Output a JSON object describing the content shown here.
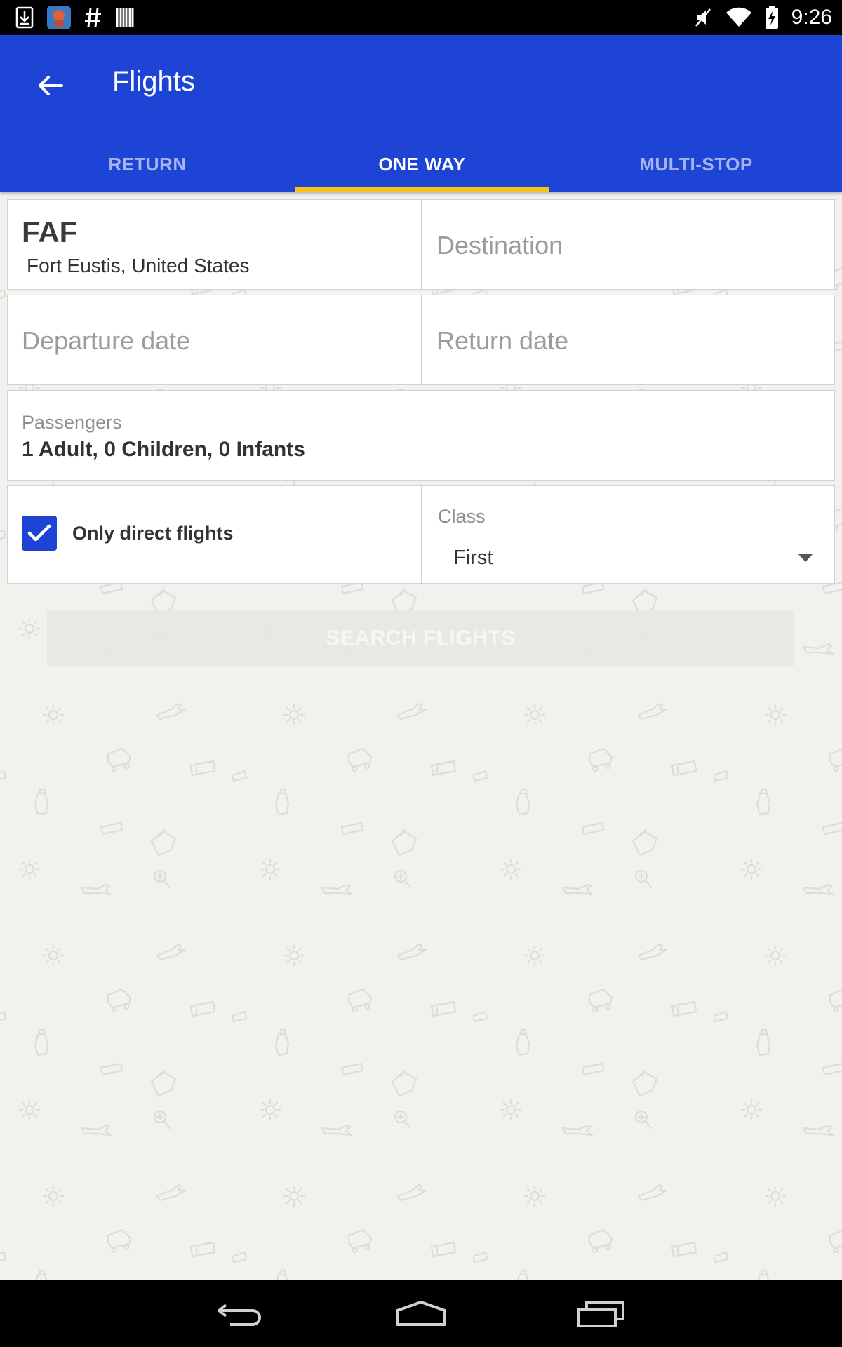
{
  "status_bar": {
    "time": "9:26",
    "left_icons": [
      "download-icon",
      "app-notification-icon",
      "hashtag-icon",
      "barcode-icon"
    ],
    "right_icons": [
      "mute-icon",
      "wifi-icon",
      "battery-charging-icon"
    ]
  },
  "app_bar": {
    "title": "Flights",
    "back_icon": "arrow-back-icon",
    "background": "#1e44d6"
  },
  "tabs": [
    {
      "label": "RETURN",
      "selected": false
    },
    {
      "label": "ONE WAY",
      "selected": true
    },
    {
      "label": "MULTI-STOP",
      "selected": false
    }
  ],
  "indicator_color": "#f5c315",
  "form": {
    "origin": {
      "code": "FAF",
      "city": "Fort Eustis, United States"
    },
    "destination": {
      "placeholder": "Destination"
    },
    "departure_date": {
      "placeholder": "Departure date"
    },
    "return_date": {
      "placeholder": "Return date"
    },
    "passengers": {
      "label": "Passengers",
      "value": "1 Adult, 0 Children, 0 Infants"
    },
    "direct_flights": {
      "label": "Only direct flights",
      "checked": true
    },
    "travel_class": {
      "label": "Class",
      "value": "First"
    }
  },
  "search_button": {
    "label": "SEARCH FLIGHTS",
    "enabled": false
  },
  "nav_bar": {
    "buttons": [
      "back-nav-icon",
      "home-nav-icon",
      "recents-nav-icon"
    ]
  }
}
